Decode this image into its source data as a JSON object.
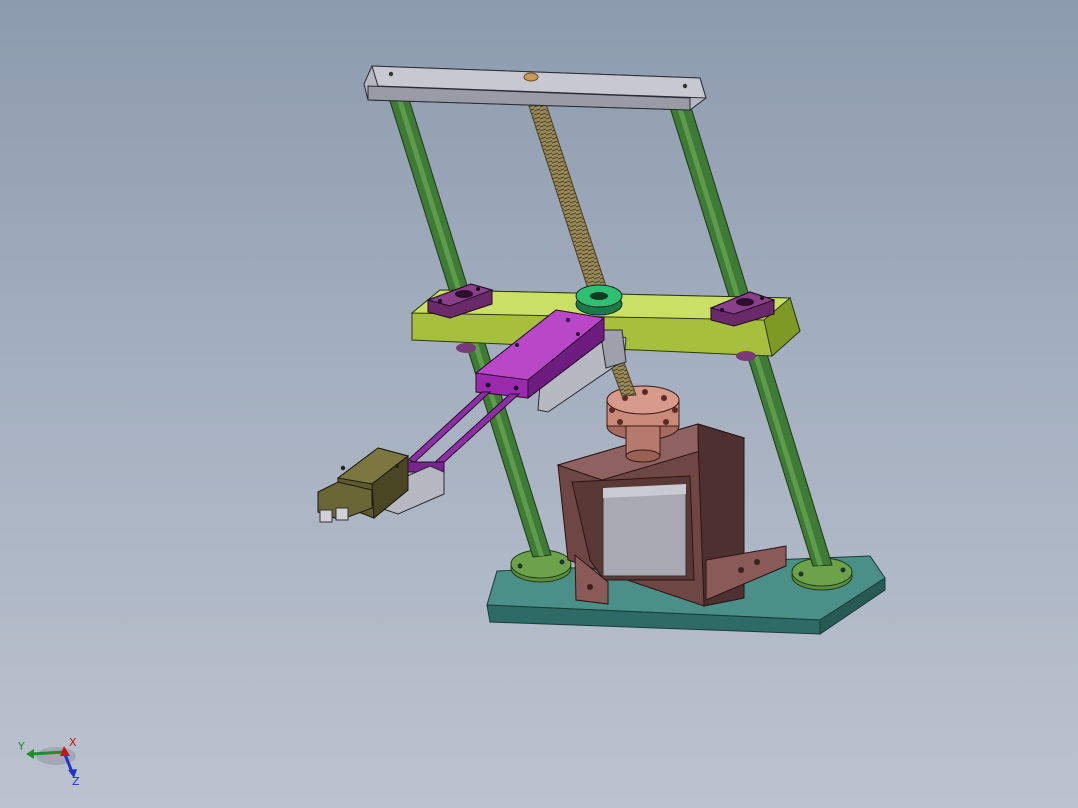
{
  "viewport": {
    "background_top": "#8c9bae",
    "background_bottom": "#bcc3cf"
  },
  "model": {
    "colors": {
      "top_plate": "#a9abb6",
      "guide_rod": "#3f7a36",
      "lead_screw": "#9a8a5a",
      "crossbeam": "#a6bf3c",
      "bearing_block": "#6a2a6a",
      "slider_block": "#9a2aae",
      "arm_rods": "#8c2fa4",
      "gripper_body": "#5f5a2e",
      "coupling": "#c98a7a",
      "motor_housing": "#8a5a58",
      "motor_face": "#a9a9b3",
      "base_plate": "#3f7e78",
      "rod_flange": "#5b8f3c",
      "bracket": "#b6b9c2"
    }
  },
  "triad": {
    "x_label": "X",
    "y_label": "Y",
    "z_label": "Z",
    "x_color": "#cc1111",
    "y_color": "#1c8f2a",
    "z_color": "#2233cc"
  }
}
